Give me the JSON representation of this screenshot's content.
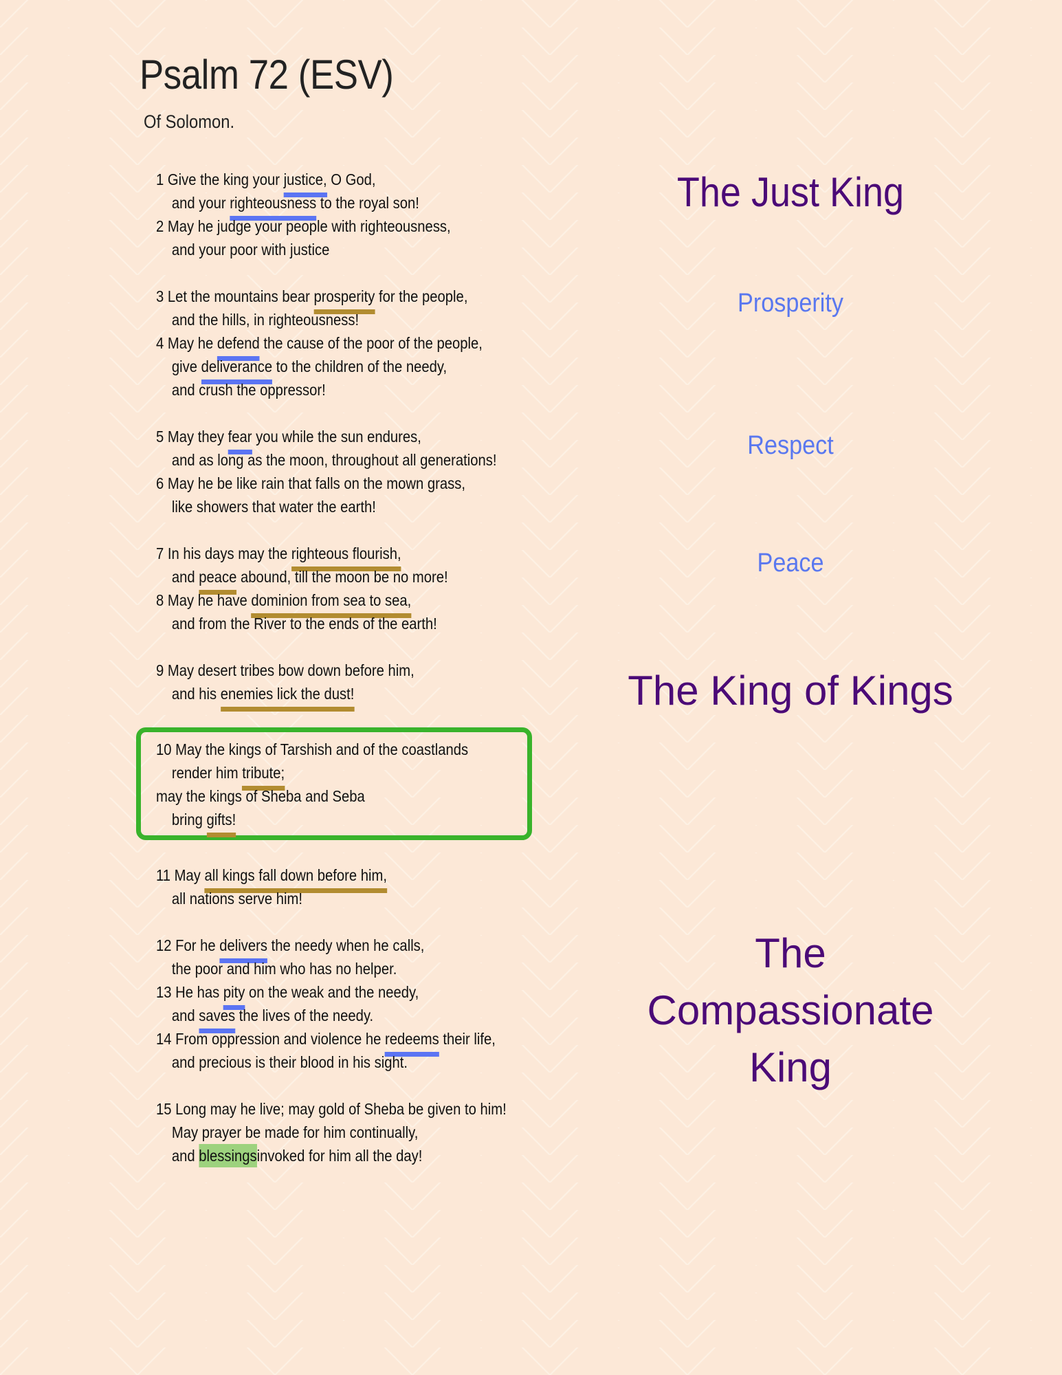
{
  "document": {
    "title": "Psalm 72 (ESV)",
    "subtitle": "Of Solomon."
  },
  "colors": {
    "background": "#fce8d7",
    "heading_major": "#4b0a77",
    "heading_minor": "#5a78ef",
    "underline_blue": "#5b74f3",
    "underline_gold": "#b28c30",
    "highlight_green": "#9dd27e",
    "box_green": "#39b32b"
  },
  "stanzas": [
    {
      "lines": [
        {
          "indent": false,
          "segments": [
            {
              "t": "1 Give the king your "
            },
            {
              "t": "justice,",
              "u": "blue"
            },
            {
              "t": " O God,"
            }
          ]
        },
        {
          "indent": true,
          "segments": [
            {
              "t": "and your "
            },
            {
              "t": "righteousness",
              "u": "blue"
            },
            {
              "t": " to the royal son!"
            }
          ]
        },
        {
          "indent": false,
          "segments": [
            {
              "t": "2 May he judge your people with righteousness,"
            }
          ]
        },
        {
          "indent": true,
          "segments": [
            {
              "t": "and your poor with justice"
            }
          ]
        }
      ]
    },
    {
      "lines": [
        {
          "indent": false,
          "segments": [
            {
              "t": "3 Let the mountains bear "
            },
            {
              "t": "prosperity",
              "u": "gold"
            },
            {
              "t": " for the people,"
            }
          ]
        },
        {
          "indent": true,
          "segments": [
            {
              "t": "and the hills, in righteousness!"
            }
          ]
        },
        {
          "indent": false,
          "segments": [
            {
              "t": "4 May he "
            },
            {
              "t": "defend",
              "u": "blue"
            },
            {
              "t": " the cause of the poor of the people,"
            }
          ]
        },
        {
          "indent": true,
          "segments": [
            {
              "t": "give "
            },
            {
              "t": "deliverance",
              "u": "blue"
            },
            {
              "t": " to the children of the needy,"
            }
          ]
        },
        {
          "indent": true,
          "segments": [
            {
              "t": "and crush the oppressor!"
            }
          ]
        }
      ]
    },
    {
      "lines": [
        {
          "indent": false,
          "segments": [
            {
              "t": "5 May they "
            },
            {
              "t": "fear",
              "u": "blue"
            },
            {
              "t": " you while the sun endures,"
            }
          ]
        },
        {
          "indent": true,
          "segments": [
            {
              "t": "and as long as the moon, throughout all generations!"
            }
          ]
        },
        {
          "indent": false,
          "segments": [
            {
              "t": "6 May he be like rain that falls on the mown grass,"
            }
          ]
        },
        {
          "indent": true,
          "segments": [
            {
              "t": "like showers that water the earth!"
            }
          ]
        }
      ]
    },
    {
      "lines": [
        {
          "indent": false,
          "segments": [
            {
              "t": "7 In his days may the "
            },
            {
              "t": "righteous flourish,",
              "u": "gold"
            }
          ]
        },
        {
          "indent": true,
          "segments": [
            {
              "t": "and "
            },
            {
              "t": "peace",
              "u": "gold"
            },
            {
              "t": " abound, till the moon be no more!"
            }
          ]
        },
        {
          "indent": false,
          "segments": [
            {
              "t": "8 May he have "
            },
            {
              "t": "dominion from sea to sea,",
              "u": "gold"
            }
          ]
        },
        {
          "indent": true,
          "segments": [
            {
              "t": "and from the River to the ends of the earth!"
            }
          ]
        }
      ]
    },
    {
      "lines": [
        {
          "indent": false,
          "segments": [
            {
              "t": "9 May desert tribes bow down before him,"
            }
          ]
        },
        {
          "indent": true,
          "segments": [
            {
              "t": "and his "
            },
            {
              "t": "enemies lick the dust!",
              "u": "gold"
            }
          ]
        }
      ]
    },
    {
      "boxed": true,
      "lines": [
        {
          "indent": false,
          "segments": [
            {
              "t": "10 May the kings of Tarshish and of the coastlands"
            }
          ]
        },
        {
          "indent": true,
          "segments": [
            {
              "t": "render him "
            },
            {
              "t": "tribute;",
              "u": "gold"
            }
          ]
        },
        {
          "indent": false,
          "segments": [
            {
              "t": "may the kings of Sheba and Seba"
            }
          ]
        },
        {
          "indent": true,
          "segments": [
            {
              "t": "bring "
            },
            {
              "t": "gifts!",
              "u": "gold"
            }
          ]
        }
      ]
    },
    {
      "lines": [
        {
          "indent": false,
          "segments": [
            {
              "t": "11 May "
            },
            {
              "t": "all kings fall down before him,",
              "u": "gold"
            }
          ]
        },
        {
          "indent": true,
          "segments": [
            {
              "t": "all nations serve him!"
            }
          ]
        }
      ]
    },
    {
      "lines": [
        {
          "indent": false,
          "segments": [
            {
              "t": "12 For he "
            },
            {
              "t": "delivers",
              "u": "blue"
            },
            {
              "t": " the needy when he calls,"
            }
          ]
        },
        {
          "indent": true,
          "segments": [
            {
              "t": "the poor and him who has no helper."
            }
          ]
        },
        {
          "indent": false,
          "segments": [
            {
              "t": "13 He has "
            },
            {
              "t": "pity",
              "u": "blue"
            },
            {
              "t": " on the weak and the needy,"
            }
          ]
        },
        {
          "indent": true,
          "segments": [
            {
              "t": "and "
            },
            {
              "t": "saves",
              "u": "blue"
            },
            {
              "t": " the lives of the needy."
            }
          ]
        },
        {
          "indent": false,
          "segments": [
            {
              "t": "14 From oppression and violence he "
            },
            {
              "t": "redeems",
              "u": "blue"
            },
            {
              "t": " their life,"
            }
          ]
        },
        {
          "indent": true,
          "segments": [
            {
              "t": "and precious is their blood in his sight."
            }
          ]
        }
      ]
    },
    {
      "lines": [
        {
          "indent": false,
          "segments": [
            {
              "t": "15 Long may he live; may gold of Sheba be given to him!"
            }
          ]
        },
        {
          "indent": true,
          "segments": [
            {
              "t": "May prayer be made for him continually,"
            }
          ]
        },
        {
          "indent": true,
          "segments": [
            {
              "t": "and "
            },
            {
              "t": "blessings ",
              "u": "green"
            },
            {
              "t": "invoked for him all the day!"
            }
          ]
        }
      ]
    }
  ],
  "headings": {
    "just_king": "The Just King",
    "prosperity": "Prosperity",
    "respect": "Respect",
    "peace": "Peace",
    "king_of_kings": "The King of Kings",
    "compassionate_1": "The",
    "compassionate_2": "Compassionate",
    "compassionate_3": "King"
  }
}
